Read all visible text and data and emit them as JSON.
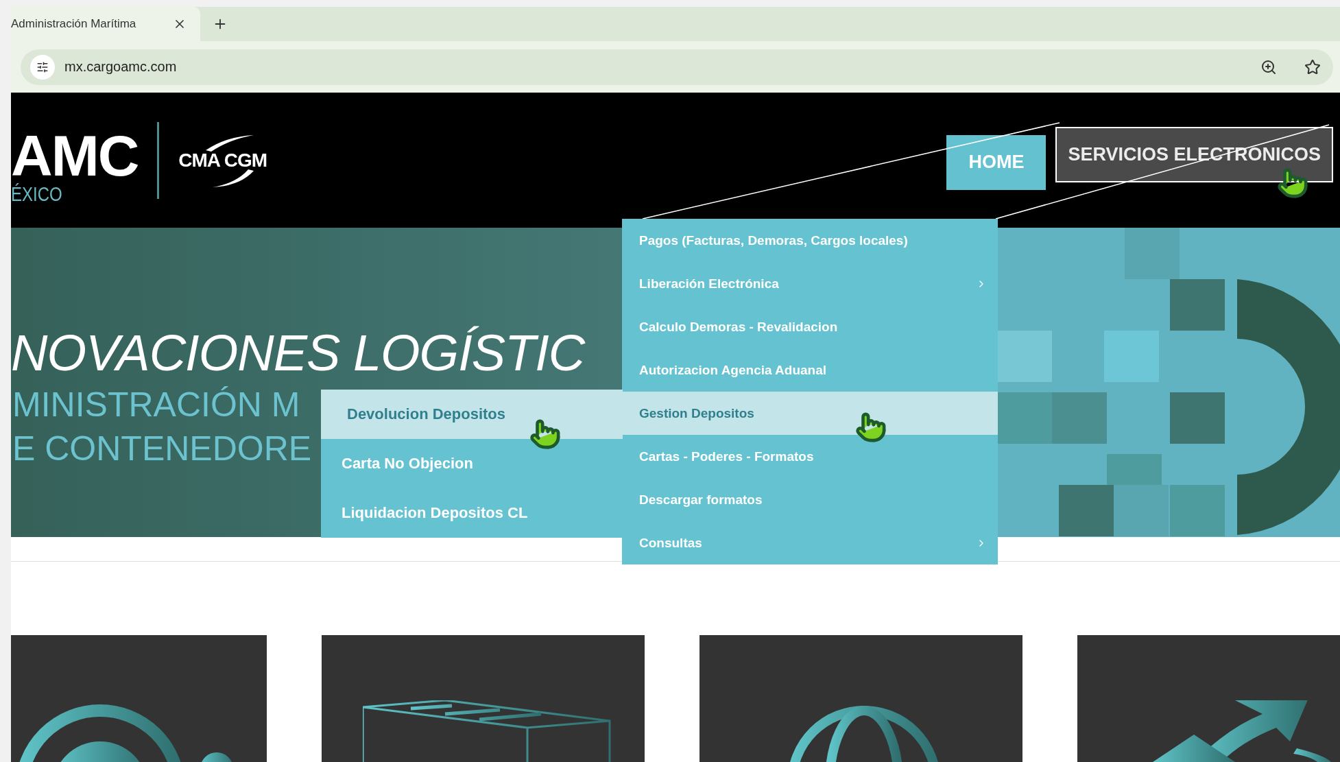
{
  "browser": {
    "tab": {
      "title": "Administración Marítima"
    },
    "address": "mx.cargoamc.com"
  },
  "header": {
    "logo": {
      "brand": "AMC",
      "region": "ÉXICO",
      "partner": "CMA CGM"
    },
    "nav": [
      {
        "label": "HOME",
        "expanded": false
      },
      {
        "label": "SERVICIOS ELECTRONICOS",
        "expanded": true
      }
    ]
  },
  "hero": {
    "title": "NOVACIONES LOGÍSTIC",
    "subtitle_lines": [
      "MINISTRACIÓN M",
      "E CONTENEDORE"
    ]
  },
  "menu": {
    "items": [
      {
        "label": "Pagos (Facturas, Demoras, Cargos locales)",
        "has_submenu": false,
        "selected": false
      },
      {
        "label": "Liberación Electrónica",
        "has_submenu": true,
        "selected": false
      },
      {
        "label": "Calculo Demoras - Revalidacion",
        "has_submenu": false,
        "selected": false
      },
      {
        "label": "Autorizacion Agencia Aduanal",
        "has_submenu": false,
        "selected": false
      },
      {
        "label": "Gestion Depositos",
        "has_submenu": false,
        "selected": true
      },
      {
        "label": "Cartas - Poderes - Formatos",
        "has_submenu": false,
        "selected": false
      },
      {
        "label": "Descargar formatos",
        "has_submenu": false,
        "selected": false
      },
      {
        "label": "Consultas",
        "has_submenu": true,
        "selected": false
      }
    ]
  },
  "submenu": {
    "items": [
      {
        "label": "Devolucion Depositos",
        "selected": true
      },
      {
        "label": "Carta No Objecion",
        "selected": false
      },
      {
        "label": "Liquidacion Depositos CL",
        "selected": false
      }
    ]
  },
  "cards": [
    {
      "kind": "money"
    },
    {
      "kind": "container"
    },
    {
      "kind": "globe"
    },
    {
      "kind": "arrow"
    }
  ]
}
